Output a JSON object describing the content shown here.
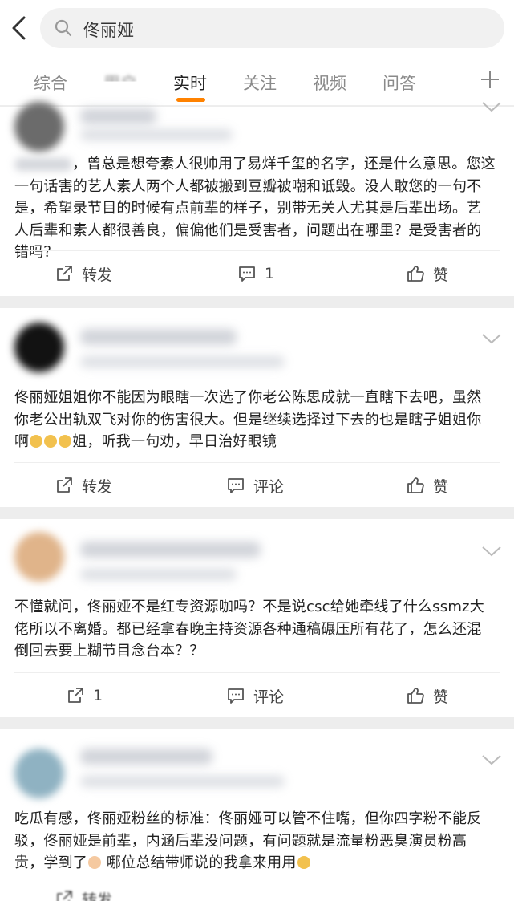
{
  "search": {
    "query": "佟丽娅"
  },
  "tabs": [
    {
      "label": "综合"
    },
    {
      "label": "用户"
    },
    {
      "label": "实时"
    },
    {
      "label": "关注"
    },
    {
      "label": "视频"
    },
    {
      "label": "问答"
    }
  ],
  "posts": [
    {
      "text": "，曾总是想夸素人很帅用了易烊千玺的名字，还是什么意思。您这一句话害的艺人素人两个人都被搬到豆瓣被嘲和诋毁。没人敢您的一句不是，希望录节目的时候有点前辈的样子，别带无关人尤其是后辈出场。艺人后辈和素人都很善良，偏偏他们是受害者，问题出在哪里？是受害者的错吗？",
      "actions": {
        "repost": "转发",
        "comment": "1",
        "like": "赞"
      }
    },
    {
      "text_main": "佟丽娅姐姐你不能因为眼瞎一次选了你老公陈思成就一直瞎下去吧，虽然你老公出轨双飞对你的伤害很大。但是继续选择过下去的也是瞎子姐姐你啊",
      "text_tail": "姐，听我一句劝，早日治好眼镜",
      "actions": {
        "repost": "转发",
        "comment": "评论",
        "like": "赞"
      }
    },
    {
      "text": "不懂就问，佟丽娅不是红专资源咖吗？不是说csc给她牵线了什么ssmz大佬所以不离婚。都已经拿春晚主持资源各种通稿碾压所有花了，怎么还混倒回去要上糊节目念台本？？",
      "actions": {
        "repost": "1",
        "comment": "评论",
        "like": "赞"
      }
    },
    {
      "text_main": "吃瓜有感，佟丽娅粉丝的标准：佟丽娅可以管不住嘴，但你四字粉不能反驳，佟丽娅是前辈，内涵后辈没问题，有问题就是流量粉恶臭演员粉高贵，学到了",
      "text_tail": " 哪位总结带师说的我拿来用用",
      "actions": {
        "repost": "转发"
      }
    }
  ]
}
